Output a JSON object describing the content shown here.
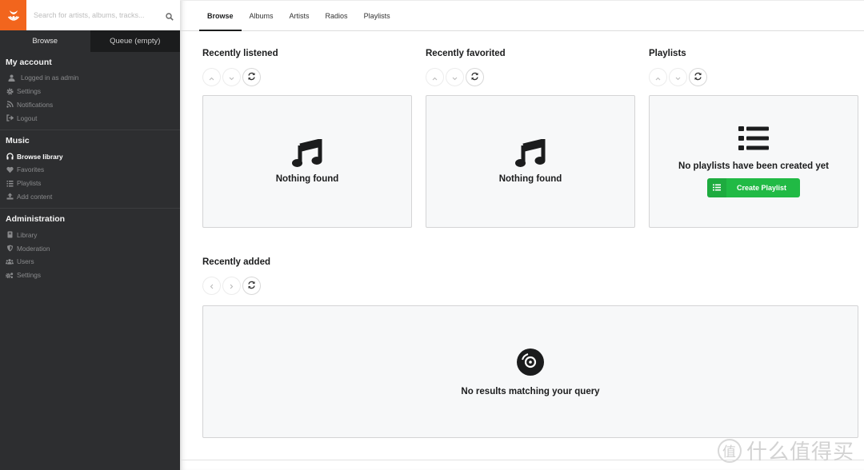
{
  "sidebar": {
    "search_placeholder": "Search for artists, albums, tracks...",
    "tabs": [
      {
        "label": "Browse",
        "active": true
      },
      {
        "label": "Queue (empty)",
        "active": false
      }
    ],
    "sections": [
      {
        "title": "My account",
        "items": [
          {
            "label": "Logged in as admin",
            "icon": "user-icon"
          },
          {
            "label": "Settings",
            "icon": "gear-icon"
          },
          {
            "label": "Notifications",
            "icon": "rss-icon"
          },
          {
            "label": "Logout",
            "icon": "sign-out-icon"
          }
        ]
      },
      {
        "title": "Music",
        "items": [
          {
            "label": "Browse library",
            "icon": "headphones-icon",
            "active": true
          },
          {
            "label": "Favorites",
            "icon": "heart-icon"
          },
          {
            "label": "Playlists",
            "icon": "list-icon"
          },
          {
            "label": "Add content",
            "icon": "upload-icon"
          }
        ]
      },
      {
        "title": "Administration",
        "items": [
          {
            "label": "Library",
            "icon": "book-icon"
          },
          {
            "label": "Moderation",
            "icon": "shield-icon"
          },
          {
            "label": "Users",
            "icon": "users-icon"
          },
          {
            "label": "Settings",
            "icon": "cogs-icon"
          }
        ]
      }
    ]
  },
  "main": {
    "tabs": [
      {
        "label": "Browse",
        "active": true
      },
      {
        "label": "Albums"
      },
      {
        "label": "Artists"
      },
      {
        "label": "Radios"
      },
      {
        "label": "Playlists"
      }
    ],
    "recently_listened": {
      "title": "Recently listened",
      "empty_text": "Nothing found"
    },
    "recently_favorited": {
      "title": "Recently favorited",
      "empty_text": "Nothing found"
    },
    "playlists": {
      "title": "Playlists",
      "empty_text": "No playlists have been created yet",
      "create_label": "Create Playlist"
    },
    "recently_added": {
      "title": "Recently added",
      "empty_text": "No results matching your query"
    }
  },
  "watermark": {
    "badge": "值",
    "text": "什么值得买"
  },
  "colors": {
    "brand": "#f2651d",
    "sidebar_bg": "#2d2e30",
    "create_button": "#21ba45"
  }
}
